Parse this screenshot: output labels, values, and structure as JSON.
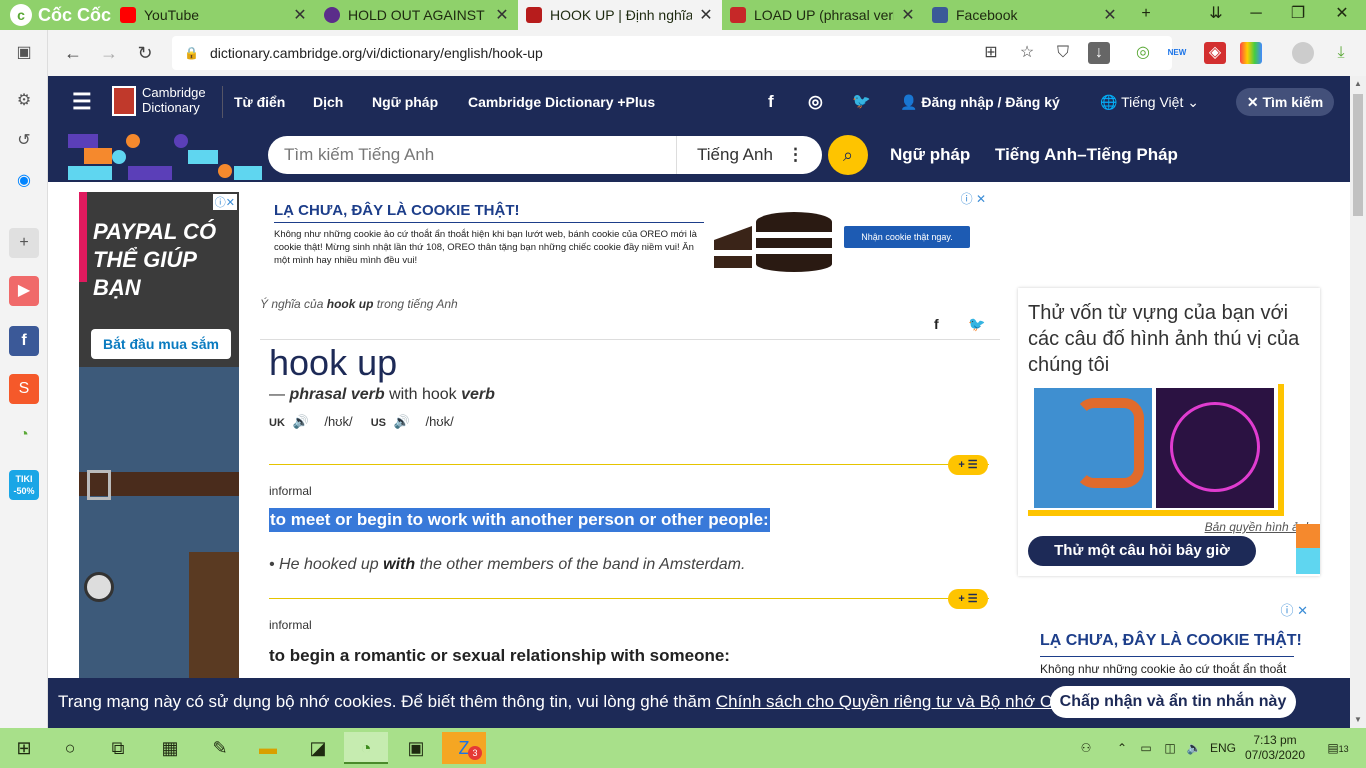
{
  "browser": {
    "brand": "Cốc Cốc",
    "tabs": [
      {
        "label": "YouTube",
        "color": "#ff0000"
      },
      {
        "label": "HOLD OUT AGAINST - Đ",
        "color": "#5b2d8a"
      },
      {
        "label": "HOOK UP | Định nghĩa t",
        "color": "#b71c1c",
        "active": true
      },
      {
        "label": "LOAD UP (phrasal verb)",
        "color": "#c62828"
      },
      {
        "label": "Facebook",
        "color": "#3b5998"
      }
    ],
    "url": "dictionary.cambridge.org/vi/dictionary/english/hook-up",
    "new_badge": "NEW"
  },
  "sidebar": {
    "badge": "TIKI -50%"
  },
  "cambridge": {
    "logo_line1": "Cambridge",
    "logo_line2": "Dictionary",
    "nav": {
      "dictionary": "Từ điển",
      "translate": "Dịch",
      "grammar": "Ngữ pháp",
      "plus": "Cambridge Dictionary +Plus",
      "login": "Đăng nhập / Đăng ký",
      "language": "Tiếng Việt",
      "search": "Tìm kiếm"
    },
    "search": {
      "placeholder": "Tìm kiếm Tiếng Anh",
      "lang": "Tiếng Anh",
      "grammar_link": "Ngữ pháp",
      "en_fr_link": "Tiếng Anh–Tiếng Pháp"
    }
  },
  "ads": {
    "left": {
      "text": "PAYPAL CÓ THỂ GIÚP BẠN",
      "button": "Bắt đầu mua sắm"
    },
    "top": {
      "title": "LẠ CHƯA, ĐÂY LÀ COOKIE THẬT!",
      "body": "Không như những cookie ảo cứ thoắt ẩn thoắt hiện khi bạn lướt web, bánh cookie của OREO mới là cookie thật! Mừng sinh nhật lần thứ 108, OREO thân tặng bạn những chiếc cookie đầy niềm vui! Ăn một mình hay nhiều mình đều vui!",
      "cta": "Nhận cookie thật ngay."
    },
    "right": {
      "title": "LẠ CHƯA, ĐÂY LÀ COOKIE THẬT!",
      "body": "Không như những cookie ảo cứ thoắt ẩn thoắt"
    }
  },
  "entry": {
    "breadcrumb_pre": "Ý nghĩa của",
    "breadcrumb_word": "hook up",
    "breadcrumb_post": "trong tiếng Anh",
    "headword": "hook up",
    "pos_dash": "—",
    "pos": "phrasal verb",
    "pos_with": "with hook",
    "pos_verb": "verb",
    "uk_label": "UK",
    "uk_ipa": "/hʊk/",
    "us_label": "US",
    "us_ipa": "/hʊk/",
    "badge": "+ ☰",
    "senses": [
      {
        "label": "informal",
        "definition": "to meet or begin to work with another person or other people:",
        "example_pre": "He hooked up",
        "example_bold": "with",
        "example_post": "the other members of the band in Amsterdam."
      },
      {
        "label": "informal",
        "definition": "to begin a romantic or sexual relationship with someone:"
      }
    ]
  },
  "quiz": {
    "text": "Thử vốn từ vựng của bạn với các câu đố hình ảnh thú vị của chúng tôi",
    "credit": "Bản quyền hình ảnh",
    "button": "Thử một câu hỏi bây giờ"
  },
  "cookie_banner": {
    "text": "Trang mạng này có sử dụng bộ nhớ cookies. Để biết thêm thông tin, vui lòng ghé thăm",
    "link": "Chính sách cho Quyền riêng tư và Bộ nhớ Cookies",
    "dot": ".",
    "button": "Chấp nhận và ẩn tin nhắn này"
  },
  "taskbar": {
    "lang": "ENG",
    "time": "7:13 pm",
    "date": "07/03/2020",
    "notif": "13",
    "zalo_badge": "3"
  }
}
